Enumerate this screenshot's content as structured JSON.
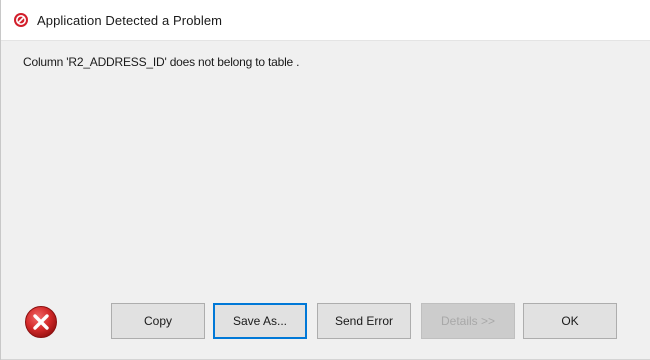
{
  "window": {
    "title": "Application Detected a Problem",
    "title_icon": "error-circle-icon"
  },
  "message": {
    "text": "Column 'R2_ADDRESS_ID' does not belong to table ."
  },
  "status_icon": "error-x-icon",
  "colors": {
    "error_red": "#d21f2b",
    "focus_blue": "#0078d7"
  },
  "buttons": {
    "copy": "Copy",
    "save_as": "Save As...",
    "send_error": "Send Error",
    "details": "Details >>",
    "ok": "OK"
  }
}
